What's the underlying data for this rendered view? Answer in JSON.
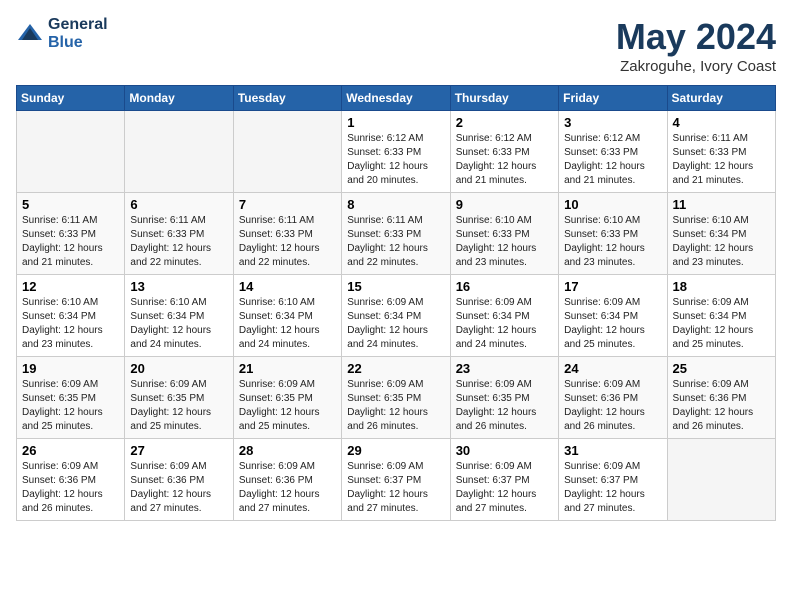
{
  "header": {
    "logo_line1": "General",
    "logo_line2": "Blue",
    "month_title": "May 2024",
    "location": "Zakroguhe, Ivory Coast"
  },
  "days_of_week": [
    "Sunday",
    "Monday",
    "Tuesday",
    "Wednesday",
    "Thursday",
    "Friday",
    "Saturday"
  ],
  "weeks": [
    [
      {
        "day": "",
        "detail": ""
      },
      {
        "day": "",
        "detail": ""
      },
      {
        "day": "",
        "detail": ""
      },
      {
        "day": "1",
        "detail": "Sunrise: 6:12 AM\nSunset: 6:33 PM\nDaylight: 12 hours\nand 20 minutes."
      },
      {
        "day": "2",
        "detail": "Sunrise: 6:12 AM\nSunset: 6:33 PM\nDaylight: 12 hours\nand 21 minutes."
      },
      {
        "day": "3",
        "detail": "Sunrise: 6:12 AM\nSunset: 6:33 PM\nDaylight: 12 hours\nand 21 minutes."
      },
      {
        "day": "4",
        "detail": "Sunrise: 6:11 AM\nSunset: 6:33 PM\nDaylight: 12 hours\nand 21 minutes."
      }
    ],
    [
      {
        "day": "5",
        "detail": "Sunrise: 6:11 AM\nSunset: 6:33 PM\nDaylight: 12 hours\nand 21 minutes."
      },
      {
        "day": "6",
        "detail": "Sunrise: 6:11 AM\nSunset: 6:33 PM\nDaylight: 12 hours\nand 22 minutes."
      },
      {
        "day": "7",
        "detail": "Sunrise: 6:11 AM\nSunset: 6:33 PM\nDaylight: 12 hours\nand 22 minutes."
      },
      {
        "day": "8",
        "detail": "Sunrise: 6:11 AM\nSunset: 6:33 PM\nDaylight: 12 hours\nand 22 minutes."
      },
      {
        "day": "9",
        "detail": "Sunrise: 6:10 AM\nSunset: 6:33 PM\nDaylight: 12 hours\nand 23 minutes."
      },
      {
        "day": "10",
        "detail": "Sunrise: 6:10 AM\nSunset: 6:33 PM\nDaylight: 12 hours\nand 23 minutes."
      },
      {
        "day": "11",
        "detail": "Sunrise: 6:10 AM\nSunset: 6:34 PM\nDaylight: 12 hours\nand 23 minutes."
      }
    ],
    [
      {
        "day": "12",
        "detail": "Sunrise: 6:10 AM\nSunset: 6:34 PM\nDaylight: 12 hours\nand 23 minutes."
      },
      {
        "day": "13",
        "detail": "Sunrise: 6:10 AM\nSunset: 6:34 PM\nDaylight: 12 hours\nand 24 minutes."
      },
      {
        "day": "14",
        "detail": "Sunrise: 6:10 AM\nSunset: 6:34 PM\nDaylight: 12 hours\nand 24 minutes."
      },
      {
        "day": "15",
        "detail": "Sunrise: 6:09 AM\nSunset: 6:34 PM\nDaylight: 12 hours\nand 24 minutes."
      },
      {
        "day": "16",
        "detail": "Sunrise: 6:09 AM\nSunset: 6:34 PM\nDaylight: 12 hours\nand 24 minutes."
      },
      {
        "day": "17",
        "detail": "Sunrise: 6:09 AM\nSunset: 6:34 PM\nDaylight: 12 hours\nand 25 minutes."
      },
      {
        "day": "18",
        "detail": "Sunrise: 6:09 AM\nSunset: 6:34 PM\nDaylight: 12 hours\nand 25 minutes."
      }
    ],
    [
      {
        "day": "19",
        "detail": "Sunrise: 6:09 AM\nSunset: 6:35 PM\nDaylight: 12 hours\nand 25 minutes."
      },
      {
        "day": "20",
        "detail": "Sunrise: 6:09 AM\nSunset: 6:35 PM\nDaylight: 12 hours\nand 25 minutes."
      },
      {
        "day": "21",
        "detail": "Sunrise: 6:09 AM\nSunset: 6:35 PM\nDaylight: 12 hours\nand 25 minutes."
      },
      {
        "day": "22",
        "detail": "Sunrise: 6:09 AM\nSunset: 6:35 PM\nDaylight: 12 hours\nand 26 minutes."
      },
      {
        "day": "23",
        "detail": "Sunrise: 6:09 AM\nSunset: 6:35 PM\nDaylight: 12 hours\nand 26 minutes."
      },
      {
        "day": "24",
        "detail": "Sunrise: 6:09 AM\nSunset: 6:36 PM\nDaylight: 12 hours\nand 26 minutes."
      },
      {
        "day": "25",
        "detail": "Sunrise: 6:09 AM\nSunset: 6:36 PM\nDaylight: 12 hours\nand 26 minutes."
      }
    ],
    [
      {
        "day": "26",
        "detail": "Sunrise: 6:09 AM\nSunset: 6:36 PM\nDaylight: 12 hours\nand 26 minutes."
      },
      {
        "day": "27",
        "detail": "Sunrise: 6:09 AM\nSunset: 6:36 PM\nDaylight: 12 hours\nand 27 minutes."
      },
      {
        "day": "28",
        "detail": "Sunrise: 6:09 AM\nSunset: 6:36 PM\nDaylight: 12 hours\nand 27 minutes."
      },
      {
        "day": "29",
        "detail": "Sunrise: 6:09 AM\nSunset: 6:37 PM\nDaylight: 12 hours\nand 27 minutes."
      },
      {
        "day": "30",
        "detail": "Sunrise: 6:09 AM\nSunset: 6:37 PM\nDaylight: 12 hours\nand 27 minutes."
      },
      {
        "day": "31",
        "detail": "Sunrise: 6:09 AM\nSunset: 6:37 PM\nDaylight: 12 hours\nand 27 minutes."
      },
      {
        "day": "",
        "detail": ""
      }
    ]
  ]
}
